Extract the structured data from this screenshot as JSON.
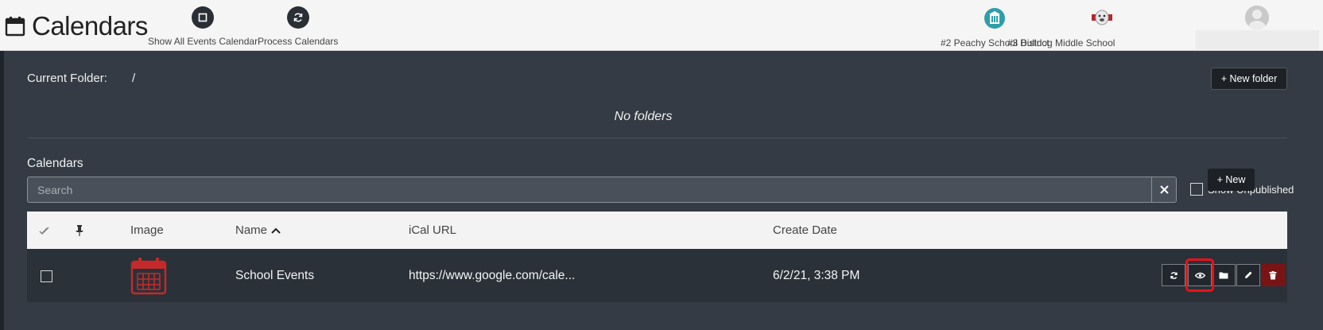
{
  "header": {
    "title": "Calendars",
    "actions": [
      {
        "label": "Show All Events Calendar",
        "icon": "square-icon"
      },
      {
        "label": "Process Calendars",
        "icon": "refresh-icon"
      }
    ],
    "orgs": [
      {
        "label": "#2 Peachy School District",
        "icon": "district-logo",
        "color": "#2f9ea8"
      },
      {
        "label": "#3 Bulldog Middle School",
        "icon": "bulldog-logo",
        "color": "#b3282d"
      }
    ],
    "user": {
      "icon": "avatar-icon"
    }
  },
  "folder": {
    "current_label": "Current Folder:",
    "current_path": "/",
    "new_folder_label": "+ New folder",
    "empty_text": "No folders"
  },
  "calendars": {
    "heading": "Calendars",
    "search_placeholder": "Search",
    "clear_icon": "close-icon",
    "show_unpublished_label": "Show Unpublished",
    "show_unpublished_checked": false,
    "columns": {
      "select_icon": "check-all-icon",
      "pin_icon": "pin-icon",
      "image": "Image",
      "name": "Name",
      "name_sort": "ascending",
      "ical": "iCal URL",
      "created": "Create Date"
    },
    "new_label": "+ New",
    "rows": [
      {
        "checked": false,
        "image_icon": "calendar-image-icon",
        "name": "School Events",
        "ical_url": "https://www.google.com/cale...",
        "created": "6/2/21, 3:38 PM",
        "actions": [
          "refresh-icon",
          "eye-icon",
          "folder-icon",
          "pencil-icon",
          "trash-icon"
        ],
        "highlighted_action": "eye-icon"
      }
    ]
  },
  "colors": {
    "accent_highlight": "#e8121a",
    "danger": "#7a1414",
    "calendar_icon": "#c42a2a",
    "page_bg": "#343b44",
    "header_bg": "#f5f5f5"
  }
}
